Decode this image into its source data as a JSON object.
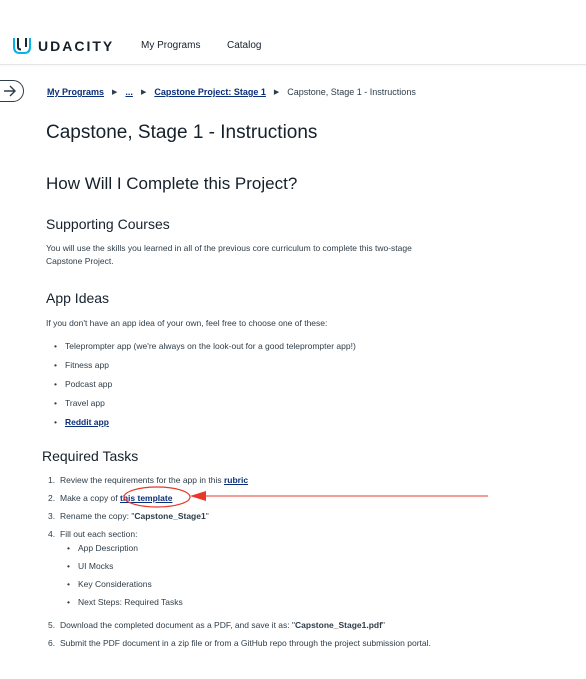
{
  "header": {
    "brand": "UDACITY",
    "nav": [
      {
        "label": "My Programs"
      },
      {
        "label": "Catalog"
      }
    ]
  },
  "breadcrumb": {
    "items": [
      {
        "label": "My Programs"
      },
      {
        "label": "..."
      },
      {
        "label": "Capstone Project: Stage 1"
      },
      {
        "label": "Capstone, Stage 1 - Instructions"
      }
    ],
    "separator": "▶"
  },
  "content": {
    "title": "Capstone, Stage 1 - Instructions",
    "question": "How Will I Complete this Project?",
    "supporting": {
      "heading": "Supporting Courses",
      "body": "You will use the skills you learned in all of the previous core curriculum to complete this two-stage Capstone Project."
    },
    "ideas": {
      "heading": "App Ideas",
      "intro": "If you don't have an app idea of your own, feel free to choose one of these:",
      "items": [
        "Teleprompter app (we're always on the look-out for a good teleprompter app!)",
        "Fitness app",
        "Podcast app",
        "Travel app",
        "Reddit app"
      ]
    },
    "tasks": {
      "heading": "Required Tasks",
      "items": [
        {
          "num": "1.",
          "text": "Review the requirements for the app in this ",
          "link": "rubric"
        },
        {
          "num": "2.",
          "text": "Make a copy of ",
          "link": "this template"
        },
        {
          "num": "3.",
          "text": "Rename the copy: \"",
          "strong": "Capstone_Stage1",
          "suffix": "\""
        },
        {
          "num": "4.",
          "text": "Fill out each section:"
        },
        {
          "num": "5.",
          "text": "Download the completed document as a PDF, and save it as: \"",
          "strong": "Capstone_Stage1.pdf",
          "suffix": "\""
        },
        {
          "num": "6.",
          "text": "Submit the PDF document in a zip file or from a GitHub repo through the project submission portal."
        }
      ],
      "sections": [
        "App Description",
        "UI Mocks",
        "Key Considerations",
        "Next Steps: Required Tasks"
      ]
    }
  },
  "colors": {
    "link": "#0a2e7a",
    "annotation": "#e8382a",
    "text": "#2e3d49"
  }
}
